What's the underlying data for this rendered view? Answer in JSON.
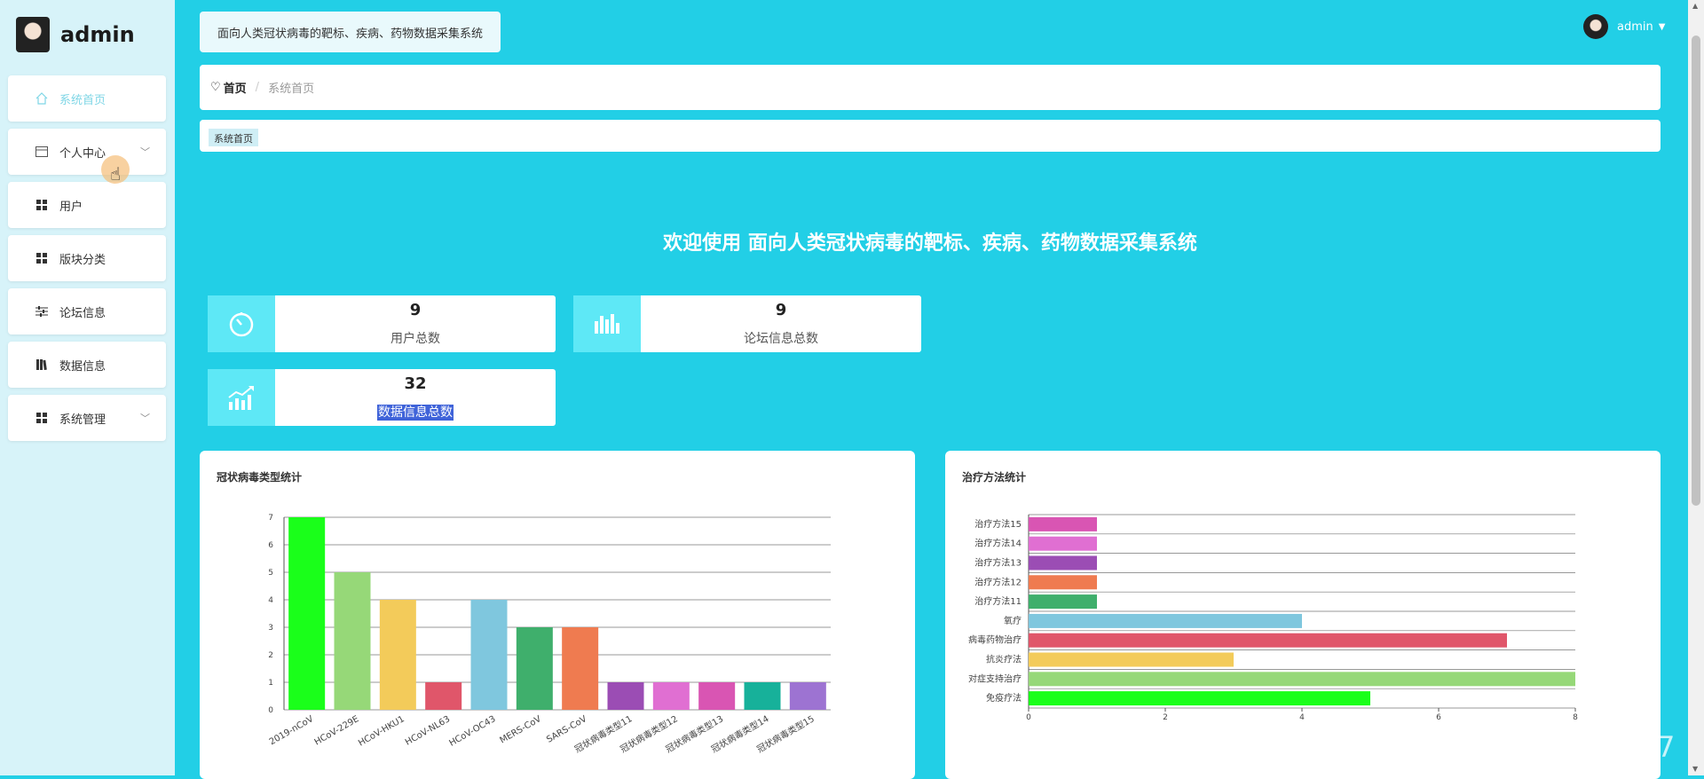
{
  "sidebar": {
    "brand_name": "admin",
    "items": [
      {
        "label": "系统首页",
        "icon": "home-icon",
        "active": true
      },
      {
        "label": "个人中心",
        "icon": "card-icon",
        "has_children": true
      },
      {
        "label": "用户",
        "icon": "grid-icon"
      },
      {
        "label": "版块分类",
        "icon": "grid-icon"
      },
      {
        "label": "论坛信息",
        "icon": "sliders-icon"
      },
      {
        "label": "数据信息",
        "icon": "book-icon"
      },
      {
        "label": "系统管理",
        "icon": "grid-icon",
        "has_children": true
      }
    ]
  },
  "header": {
    "system_title": "面向人类冠状病毒的靶标、疾病、药物数据采集系统",
    "user_name": "admin"
  },
  "breadcrumb": {
    "home": "首页",
    "current": "系统首页"
  },
  "tags": {
    "active_tag": "系统首页"
  },
  "welcome": "欢迎使用 面向人类冠状病毒的靶标、疾病、药物数据采集系统",
  "stats": [
    {
      "value": "9",
      "label": "用户总数",
      "icon": "timer-icon"
    },
    {
      "value": "9",
      "label": "论坛信息总数",
      "icon": "bar-chart-icon"
    },
    {
      "value": "32",
      "label": "数据信息总数",
      "icon": "trend-chart-icon"
    }
  ],
  "chart_data": [
    {
      "type": "bar",
      "title": "冠状病毒类型统计",
      "categories": [
        "2019-nCoV",
        "HCoV-229E",
        "HCoV-HKU1",
        "HCoV-NL63",
        "HCoV-OC43",
        "MERS-CoV",
        "SARS-CoV",
        "冠状病毒类型11",
        "冠状病毒类型12",
        "冠状病毒类型13",
        "冠状病毒类型14",
        "冠状病毒类型15"
      ],
      "values": [
        7,
        5,
        4,
        1,
        4,
        3,
        3,
        1,
        1,
        1,
        1,
        1
      ],
      "colors": [
        "#1aff1a",
        "#96d878",
        "#f3cb5a",
        "#e0566a",
        "#7fc7de",
        "#3faf6c",
        "#ef7b50",
        "#9b4db4",
        "#e06fd2",
        "#d955b3",
        "#17b19a",
        "#9d73d2"
      ],
      "ylim": [
        0,
        7
      ],
      "yticks": [
        "0",
        "1",
        "2",
        "3",
        "4",
        "5",
        "6",
        "7"
      ],
      "grid": true
    },
    {
      "type": "bar",
      "orientation": "horizontal",
      "title": "治疗方法统计",
      "categories": [
        "免疫疗法",
        "对症支持治疗",
        "抗炎疗法",
        "病毒药物治疗",
        "氧疗",
        "治疗方法11",
        "治疗方法12",
        "治疗方法13",
        "治疗方法14",
        "治疗方法15"
      ],
      "values": [
        5,
        8,
        3,
        7,
        4,
        1,
        1,
        1,
        1,
        1
      ],
      "colors": [
        "#1aff1a",
        "#96d878",
        "#f3cb5a",
        "#e0566a",
        "#7fc7de",
        "#3faf6c",
        "#ef7b50",
        "#9b4db4",
        "#e06fd2",
        "#d955b3"
      ],
      "xlim": [
        0,
        8
      ],
      "xticks": [
        "0",
        "2",
        "4",
        "6",
        "8"
      ],
      "grid": true
    }
  ],
  "watermark": "CSDN @QQ3295391197"
}
